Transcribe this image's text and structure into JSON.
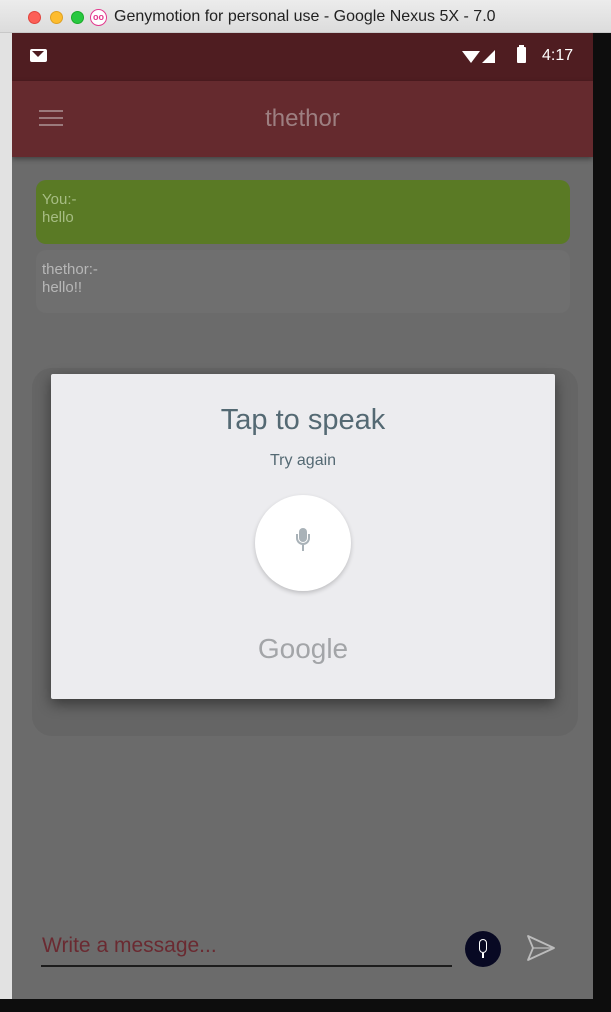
{
  "window": {
    "title": "Genymotion for personal use - Google Nexus 5X - 7.0",
    "logo_glyph": "oo"
  },
  "status_bar": {
    "time": "4:17",
    "icons": [
      "gmail-icon",
      "wifi-icon",
      "signal-icon",
      "battery-charging-icon"
    ]
  },
  "toolbar": {
    "title": "thethor",
    "menu_icon": "hamburger-menu-icon"
  },
  "messages": [
    {
      "sender": "You:-",
      "text": "hello"
    },
    {
      "sender": "thethor:-",
      "text": "hello!!"
    }
  ],
  "voice_dialog": {
    "title": "Tap to speak",
    "subtitle": "Try again",
    "mic_icon": "microphone-icon",
    "brand": "Google"
  },
  "input_bar": {
    "placeholder": "Write a message...",
    "voice_icon": "microphone-icon",
    "send_icon": "send-icon"
  },
  "colors": {
    "statusbar": "#4f1d21",
    "toolbar": "#652a2e",
    "user_bubble": "#5a7a25",
    "bot_bubble": "#6f6f6f",
    "dialog_bg": "#ececef",
    "voice_button": "#080923"
  }
}
